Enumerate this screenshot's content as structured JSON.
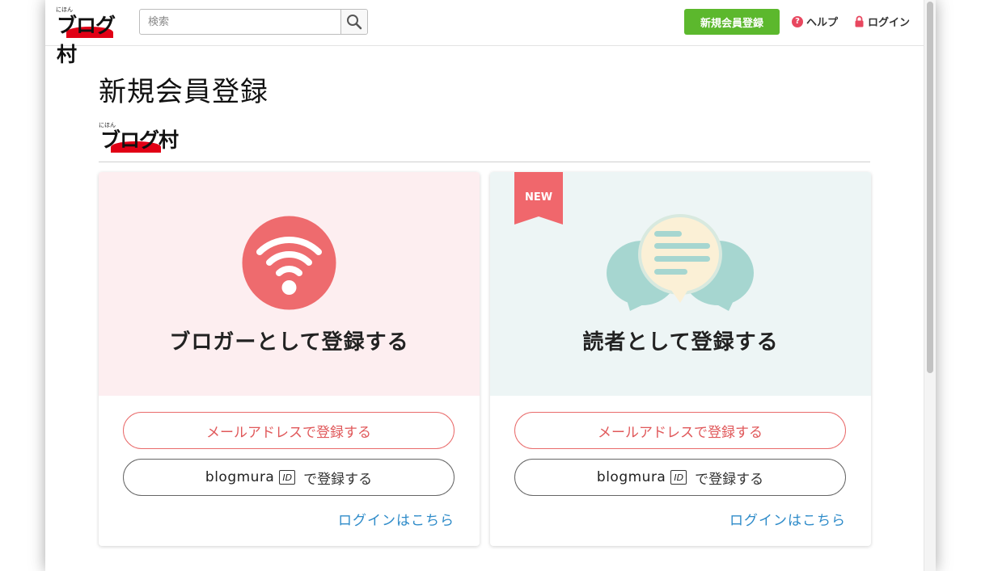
{
  "header": {
    "logo": {
      "kana": "にほん",
      "main": "ブログ村"
    },
    "search": {
      "placeholder": "検索"
    },
    "register_label": "新規会員登録",
    "help_label": "ヘルプ",
    "login_label": "ログイン"
  },
  "main": {
    "title": "新規会員登録",
    "logo": {
      "kana": "にほん",
      "main": "ブログ村"
    },
    "cards": [
      {
        "heading": "ブロガーとして登録する",
        "email_button": "メールアドレスで登録する",
        "id_brand": "blogmura",
        "id_badge": "ID",
        "id_suffix": "で登録する",
        "login_link": "ログインはこちら",
        "icon": "wifi-icon"
      },
      {
        "badge": "NEW",
        "heading": "読者として登録する",
        "email_button": "メールアドレスで登録する",
        "id_brand": "blogmura",
        "id_badge": "ID",
        "id_suffix": "で登録する",
        "login_link": "ログインはこちら",
        "icon": "chat-bubbles-icon"
      }
    ]
  },
  "colors": {
    "register_green": "#5cb82d",
    "accent_red": "#e96b6b",
    "link_blue": "#2e8bc9",
    "blogger_bg": "#fdeef0",
    "reader_bg": "#edf5f5"
  }
}
